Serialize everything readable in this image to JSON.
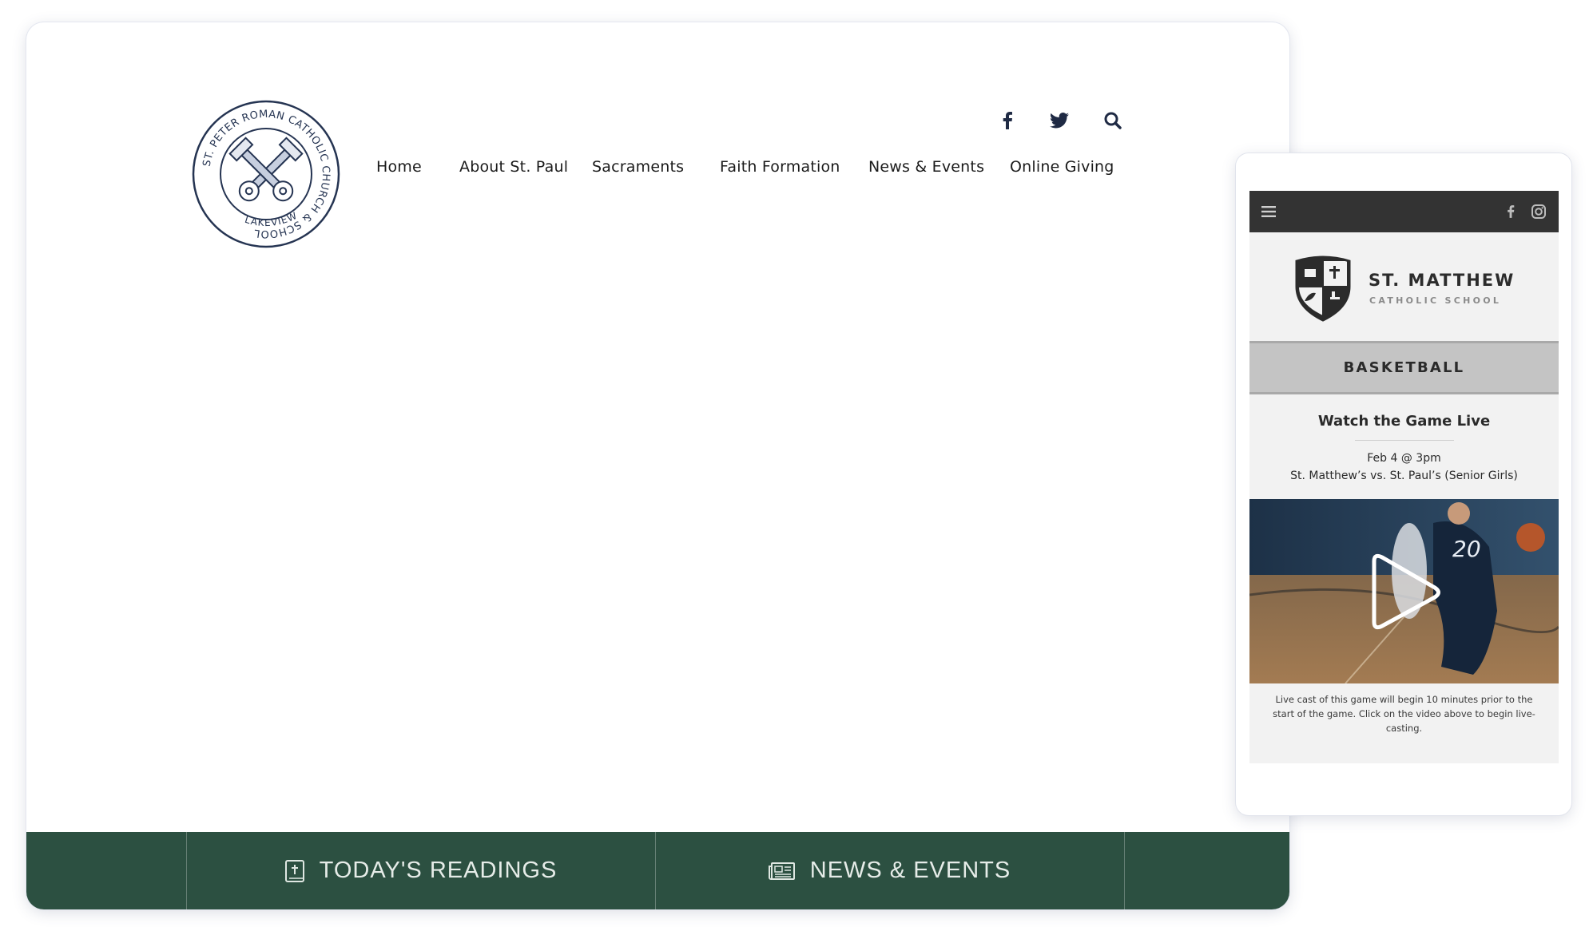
{
  "desktop": {
    "logo": {
      "ring_text": "ST. PETER ROMAN CATHOLIC CHURCH & SCHOOL",
      "bottom_text": "LAKEVIEW"
    },
    "social_icons": [
      "facebook-icon",
      "twitter-icon",
      "search-icon"
    ],
    "nav": [
      {
        "label": "Home"
      },
      {
        "label": "About St. Paul"
      },
      {
        "label": "Sacraments"
      },
      {
        "label": "Faith Formation"
      },
      {
        "label": "News & Events"
      },
      {
        "label": "Online Giving"
      }
    ],
    "bottom_bar": {
      "readings_label": "TODAY'S READINGS",
      "news_label": "NEWS & EVENTS"
    },
    "colors": {
      "accent": "#2c5041",
      "nav_icon": "#1f2a44"
    }
  },
  "mobile": {
    "topbar_icons": [
      "menu-icon",
      "facebook-icon",
      "instagram-icon"
    ],
    "brand": {
      "name": "ST. MATTHEW",
      "subtitle": "CATHOLIC SCHOOL"
    },
    "section_title": "BASKETBALL",
    "heading": "Watch the Game Live",
    "date": "Feb 4 @ 3pm",
    "matchup": "St. Matthew’s vs. St. Paul’s (Senior Girls)",
    "video": {
      "jersey_number": "20"
    },
    "caption": "Live cast of this game will begin 10 minutes prior to the start of the game. Click on the video above to begin live-casting.",
    "colors": {
      "topbar": "#333333",
      "section": "#c4c4c4"
    }
  }
}
